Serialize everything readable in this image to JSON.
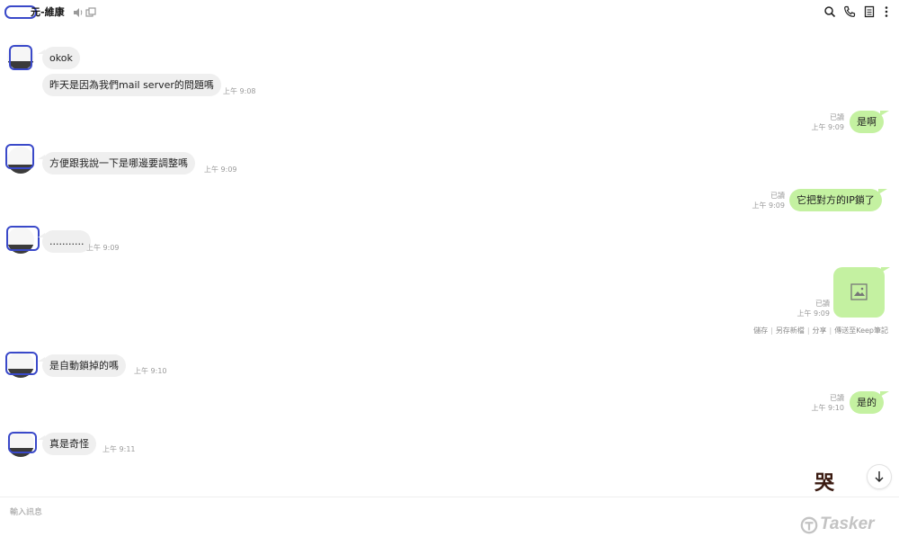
{
  "header": {
    "title": "元-維康",
    "icons": [
      "mute-icon",
      "popout-icon",
      "search-icon",
      "call-icon",
      "notes-icon",
      "more-icon"
    ]
  },
  "messages": [
    {
      "side": "in",
      "text": "okok",
      "time": ""
    },
    {
      "side": "in",
      "text": "昨天是因為我們mail server的問題嗎",
      "time": "上午 9:08"
    },
    {
      "side": "out",
      "text": "是啊",
      "read": "已讀",
      "time": "上午 9:09"
    },
    {
      "side": "in",
      "text": "方便跟我說一下是哪邊要調整嗎",
      "time": "上午 9:09"
    },
    {
      "side": "out",
      "text": "它把對方的IP鎖了",
      "read": "已讀",
      "time": "上午 9:09"
    },
    {
      "side": "in",
      "text": "...........",
      "time": "上午 9:09"
    },
    {
      "side": "out",
      "type": "image",
      "read": "已讀",
      "time": "上午 9:09"
    },
    {
      "side": "in",
      "text": "是自動鎖掉的嗎",
      "time": "上午 9:10"
    },
    {
      "side": "out",
      "text": "是的",
      "read": "已讀",
      "time": "上午 9:10"
    },
    {
      "side": "in",
      "text": "真是奇怪",
      "time": "上午 9:11"
    }
  ],
  "image_actions": {
    "save": "儲存",
    "save_as": "另存新檔",
    "share": "分享",
    "send_keep": "傳送至Keep筆記"
  },
  "composer": {
    "placeholder": "輸入訊息"
  },
  "sticker": "哭",
  "watermark": "Tasker",
  "colors": {
    "outgoing_bubble": "#c4f1a1",
    "incoming_bubble": "#efefef",
    "redaction": "#3a49c9"
  }
}
